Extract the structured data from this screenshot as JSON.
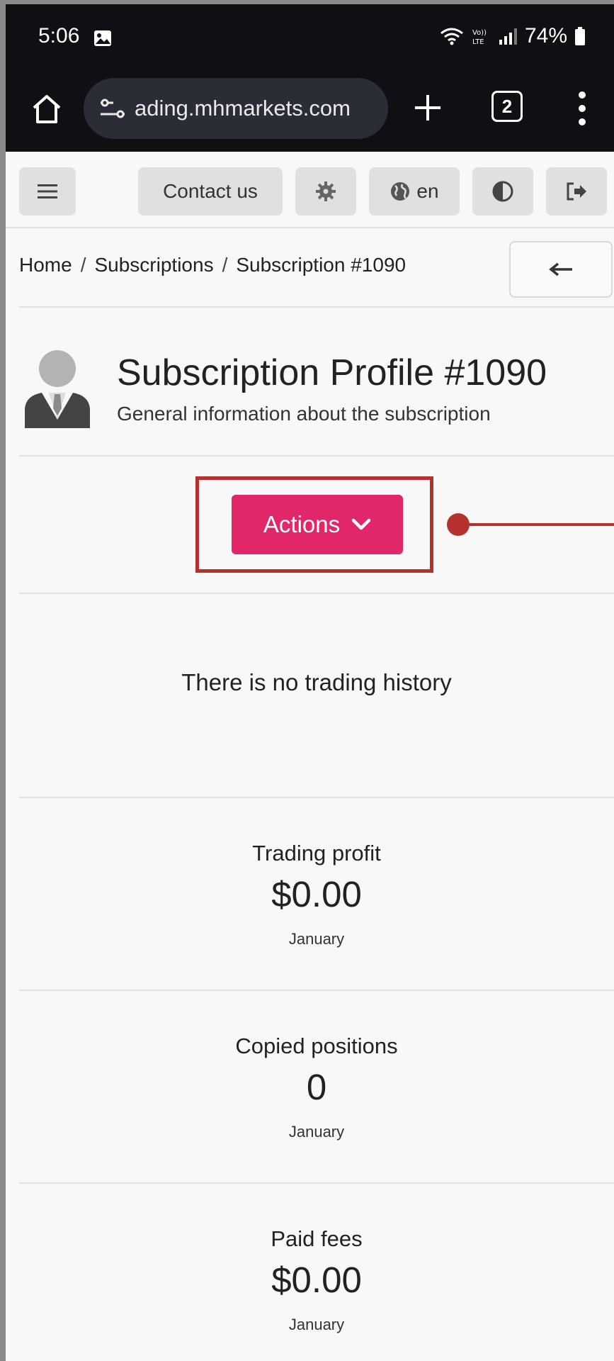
{
  "status_bar": {
    "time": "5:06",
    "battery": "74%"
  },
  "browser": {
    "url": "ading.mhmarkets.com",
    "tab_count": "2"
  },
  "top_nav": {
    "contact_label": "Contact us",
    "language": "en"
  },
  "breadcrumb": {
    "items": [
      "Home",
      "Subscriptions",
      "Subscription #1090"
    ]
  },
  "profile": {
    "title": "Subscription Profile #1090",
    "subtitle": "General information about the subscription"
  },
  "actions": {
    "label": "Actions",
    "color": "#e2266a",
    "highlight_color": "#b5312d"
  },
  "history": {
    "empty_text": "There is no trading history"
  },
  "stats": [
    {
      "label": "Trading profit",
      "value": "$0.00",
      "period": "January"
    },
    {
      "label": "Copied positions",
      "value": "0",
      "period": "January"
    },
    {
      "label": "Paid fees",
      "value": "$0.00",
      "period": "January"
    }
  ]
}
